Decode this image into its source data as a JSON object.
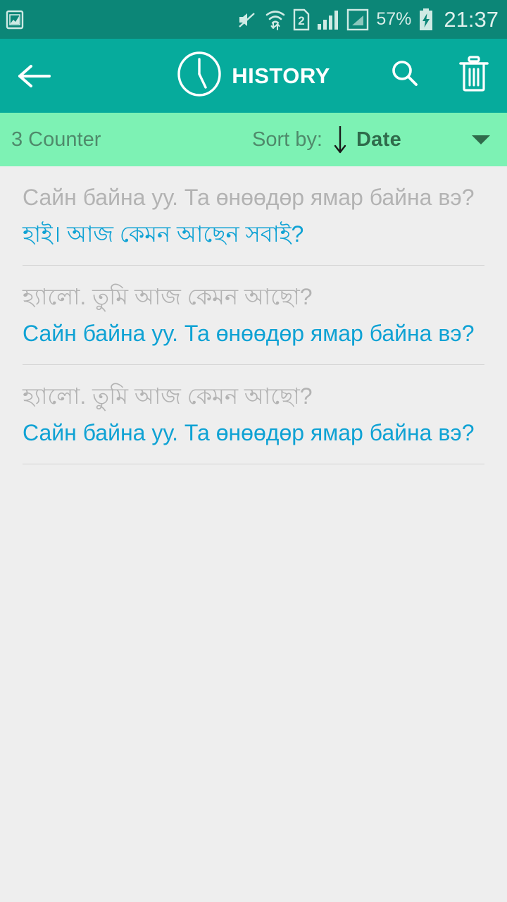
{
  "status_bar": {
    "left_icons": [
      {
        "name": "image-icon",
        "glyph": "picture"
      }
    ],
    "right_icons": [
      {
        "name": "mute-icon",
        "glyph": "speaker-muted"
      },
      {
        "name": "wifi-transfer-icon",
        "glyph": "wifi-updown"
      },
      {
        "name": "sim2-icon",
        "glyph": "sim-card-2",
        "label": "2"
      },
      {
        "name": "signal-bars-icon",
        "glyph": "signal-full"
      },
      {
        "name": "signal-bars-secondary-icon",
        "glyph": "signal-partial-boxed"
      }
    ],
    "battery_percent": "57%",
    "battery_state": "charging",
    "clock": "21:37"
  },
  "app_bar": {
    "back_label": "Back",
    "clock_icon": "clock-icon",
    "title": "HISTORY",
    "search_label": "Search",
    "delete_label": "Delete all"
  },
  "sort_bar": {
    "counter": "3 Counter",
    "sort_by_label": "Sort by:",
    "direction": "descending",
    "sort_value": "Date",
    "dropdown_caret": "chevron-down-icon"
  },
  "history": {
    "entries": [
      {
        "source": "Сайн байна уу. Та өнөөдөр ямар байна вэ?",
        "target": "হাই। আজ কেমন আছেন সবাই?"
      },
      {
        "source": "হ্যালো. তুমি আজ কেমন আছো?",
        "target": "Сайн байна уу. Та өнөөдөр ямар байна вэ?"
      },
      {
        "source": "হ্যালো. তুমি আজ কেমন আছো?",
        "target": "Сайн байна уу. Та өнөөдөр ямар байна вэ?"
      }
    ]
  },
  "colors": {
    "status_bar_bg": "#0c8677",
    "app_bar_bg": "#06ab9c",
    "sort_bar_bg": "#7df2b4",
    "page_bg": "#eeeeee",
    "source_text": "#b3b3b3",
    "target_text": "#0fa2d4",
    "divider": "#d4d4d4"
  }
}
